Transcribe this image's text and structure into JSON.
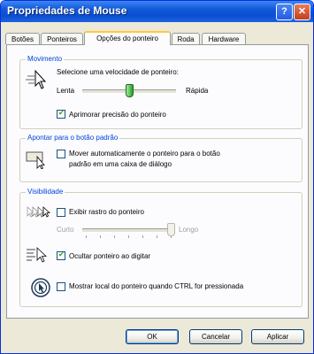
{
  "window": {
    "title": "Propriedades de Mouse"
  },
  "tabs": [
    {
      "label": "Botões"
    },
    {
      "label": "Ponteiros"
    },
    {
      "label": "Opções do ponteiro"
    },
    {
      "label": "Roda"
    },
    {
      "label": "Hardware"
    }
  ],
  "active_tab": "Opções do ponteiro",
  "movimento": {
    "title": "Movimento",
    "speed_label": "Selecione uma velocidade de ponteiro:",
    "slow": "Lenta",
    "fast": "Rápida",
    "speed_value": 0.5,
    "precision_label": "Aprimorar precisão do ponteiro",
    "precision_checked": true
  },
  "snap": {
    "title": "Apontar para o botão padrão",
    "label_line1": "Mover automaticamente o ponteiro para o botão",
    "label_line2": "padrão em uma caixa de diálogo",
    "checked": false
  },
  "visibilidade": {
    "title": "Visibilidade",
    "trails_label": "Exibir rastro do ponteiro",
    "trails_checked": false,
    "short": "Curto",
    "long": "Longo",
    "trail_value": 1.0,
    "hide_label": "Ocultar ponteiro ao digitar",
    "hide_checked": true,
    "ctrl_label": "Mostrar local do ponteiro quando CTRL for pressionada",
    "ctrl_checked": false
  },
  "buttons": {
    "ok": "OK",
    "cancel": "Cancelar",
    "apply": "Aplicar"
  },
  "colors": {
    "titlebar": "#0a4fd1",
    "group_title": "#0046d5",
    "face": "#ece9d8"
  }
}
